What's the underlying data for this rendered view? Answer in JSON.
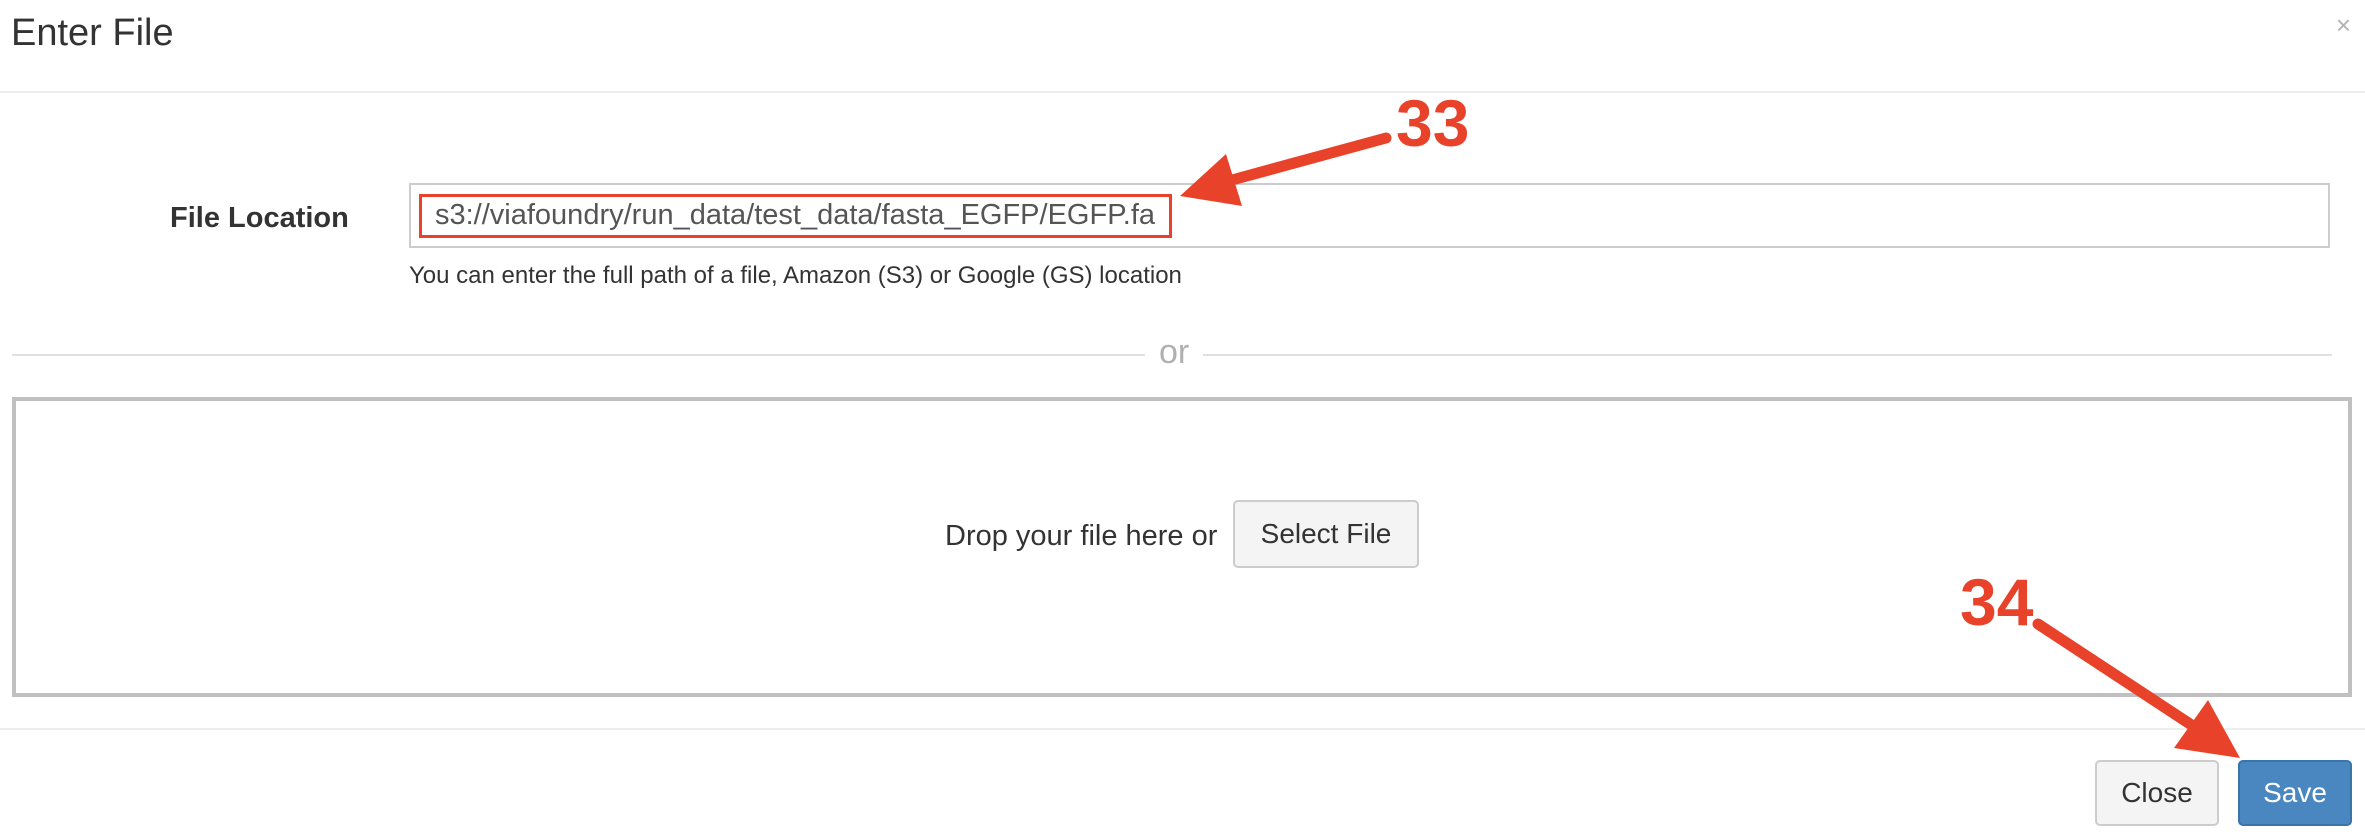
{
  "dialog": {
    "title": "Enter File",
    "close_icon": "×"
  },
  "form": {
    "file_location_label": "File Location",
    "file_location_value": "s3://viafoundry/run_data/test_data/fasta_EGFP/EGFP.fa",
    "helper_text": "You can enter the full path of a file, Amazon (S3) or Google (GS) location"
  },
  "divider": {
    "or_text": "or"
  },
  "dropzone": {
    "text": "Drop your file here or",
    "select_button": "Select File"
  },
  "footer": {
    "close_button": "Close",
    "save_button": "Save"
  },
  "annotations": {
    "step_33": "33",
    "step_34": "34",
    "color": "#e8432a"
  },
  "colors": {
    "primary": "#4a86c0",
    "annotation": "#e8432a"
  }
}
